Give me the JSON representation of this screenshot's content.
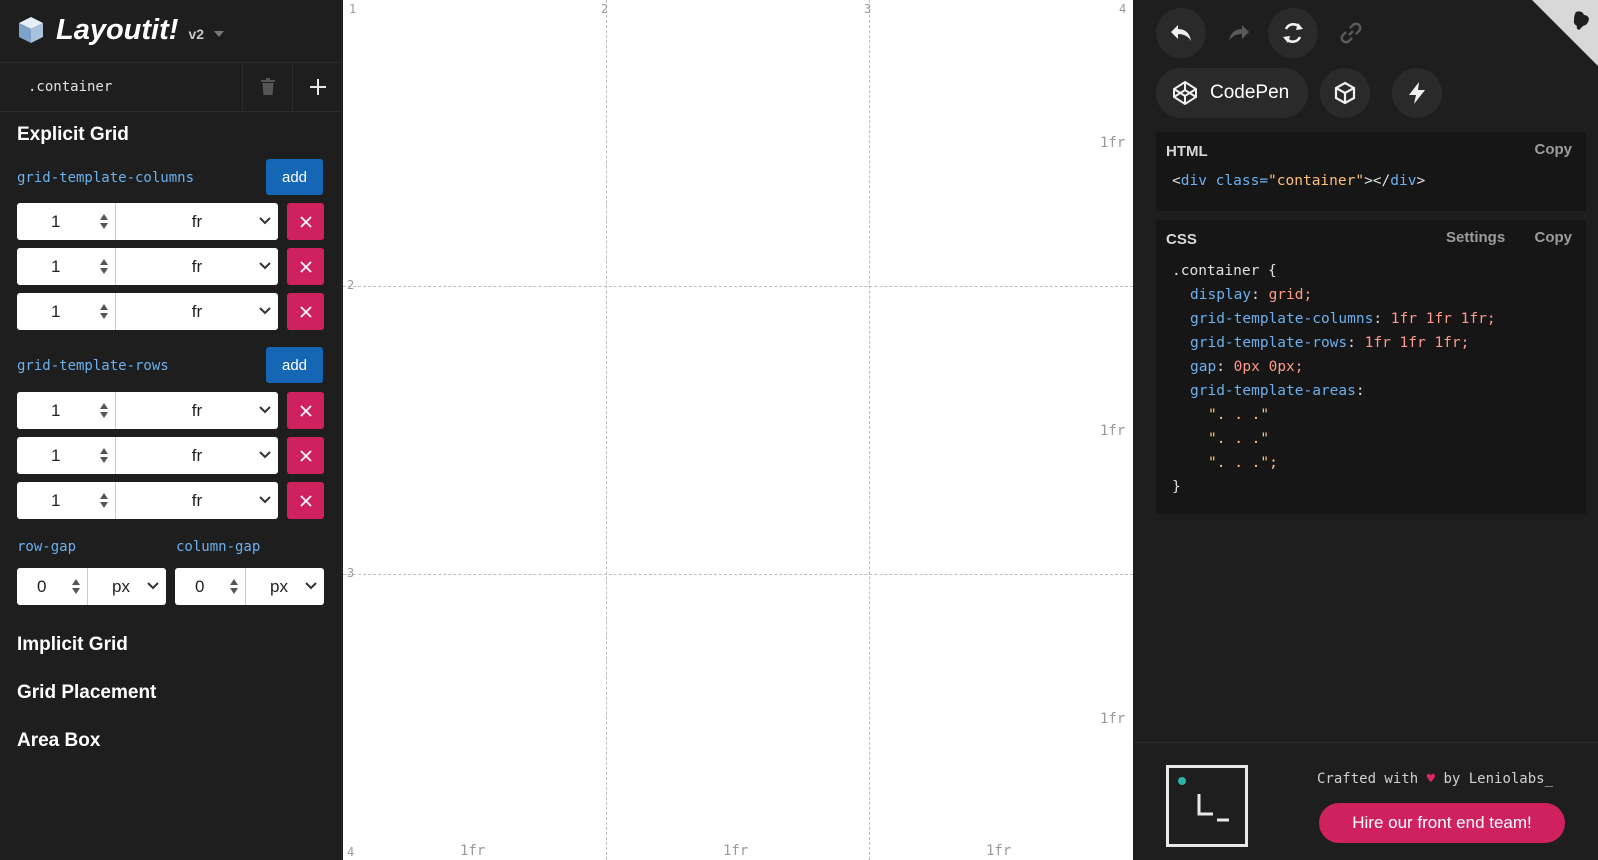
{
  "app": {
    "name": "Layoutit!",
    "version": "v2"
  },
  "container": {
    "name": ".container"
  },
  "sections": {
    "explicit": "Explicit Grid",
    "implicit": "Implicit Grid",
    "placement": "Grid Placement",
    "area": "Area Box"
  },
  "columns": {
    "label": "grid-template-columns",
    "add_label": "add",
    "tracks": [
      {
        "value": "1",
        "unit": "fr"
      },
      {
        "value": "1",
        "unit": "fr"
      },
      {
        "value": "1",
        "unit": "fr"
      }
    ]
  },
  "rows": {
    "label": "grid-template-rows",
    "add_label": "add",
    "tracks": [
      {
        "value": "1",
        "unit": "fr"
      },
      {
        "value": "1",
        "unit": "fr"
      },
      {
        "value": "1",
        "unit": "fr"
      }
    ]
  },
  "gaps": {
    "row_label": "row-gap",
    "row_value": "0",
    "row_unit": "px",
    "column_label": "column-gap",
    "column_value": "0",
    "column_unit": "px"
  },
  "canvas": {
    "col_lines": [
      "1",
      "2",
      "3",
      "4"
    ],
    "row_lines": [
      "2",
      "3",
      "4"
    ],
    "col_tracks": [
      "1fr",
      "1fr",
      "1fr"
    ],
    "row_tracks": [
      "1fr",
      "1fr",
      "1fr"
    ]
  },
  "toolbar": {
    "codepen_label": "CodePen"
  },
  "html_code": {
    "title": "HTML",
    "copy_label": "Copy",
    "open": "<",
    "tag": "div",
    "attr": " class=",
    "value": "\"container\"",
    "mid": "></",
    "close": ">"
  },
  "css_code": {
    "title": "CSS",
    "settings_label": "Settings",
    "copy_label": "Copy",
    "selector_line": ".container {",
    "props": [
      {
        "name": "display",
        "value": "grid;"
      },
      {
        "name": "grid-template-columns",
        "value": "1fr 1fr 1fr;"
      },
      {
        "name": "grid-template-rows",
        "value": "1fr 1fr 1fr;"
      },
      {
        "name": "gap",
        "value": "0px 0px;"
      },
      {
        "name": "grid-template-areas",
        "value": ""
      }
    ],
    "areas": [
      "\". . .\"",
      "\". . .\"",
      "\". . .\";"
    ],
    "closing": "}"
  },
  "footer": {
    "crafted_prefix": "Crafted with ",
    "heart": "♥",
    "crafted_suffix": " by Leniolabs_",
    "hire_label": "Hire our front end team!",
    "logo_glyph": "L_"
  },
  "colors": {
    "accent_blue": "#1566b4",
    "danger_pink": "#d0215f",
    "code_blue": "#6cb0ee",
    "code_string": "#ffc07a",
    "code_value": "#ff9a8a"
  }
}
